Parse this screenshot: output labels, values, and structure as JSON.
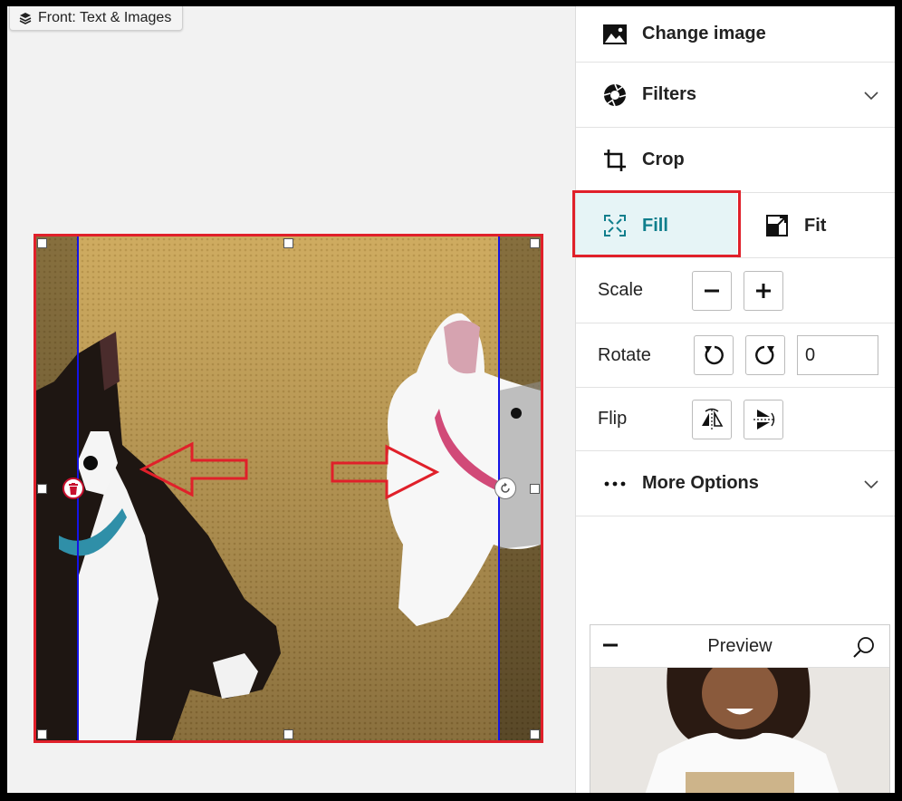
{
  "layer_tag": {
    "label": "Front: Text & Images"
  },
  "panel": {
    "change_image": "Change image",
    "filters": "Filters",
    "crop": "Crop",
    "fill": "Fill",
    "fit": "Fit",
    "scale": "Scale",
    "rotate": "Rotate",
    "rotate_value": "0",
    "flip": "Flip",
    "more_options": "More Options"
  },
  "preview": {
    "title": "Preview"
  },
  "colors": {
    "accent": "#0f7e8c",
    "fill_selected_bg": "#e6f4f6",
    "annotation_red": "#e0202a",
    "guide_blue": "#1414e6"
  }
}
